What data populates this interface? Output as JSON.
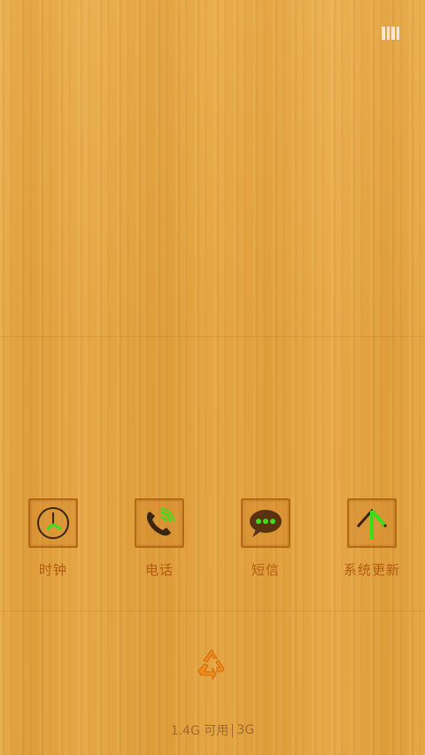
{
  "status_bar": {
    "icon": "battery-outline-icon"
  },
  "apps": [
    {
      "label": "时钟",
      "icon": "clock-icon"
    },
    {
      "label": "电话",
      "icon": "phone-icon"
    },
    {
      "label": "短信",
      "icon": "message-icon"
    },
    {
      "label": "系统更新",
      "icon": "update-arrow-icon"
    }
  ],
  "cleaner": {
    "icon": "recycle-icon",
    "free_memory": "1.4G 可用",
    "network": "3G"
  },
  "colors": {
    "wallpaper": "#e3a23f",
    "icon_frame": "#b56914",
    "label": "#b35a12",
    "accent_green": "#38e01c"
  }
}
